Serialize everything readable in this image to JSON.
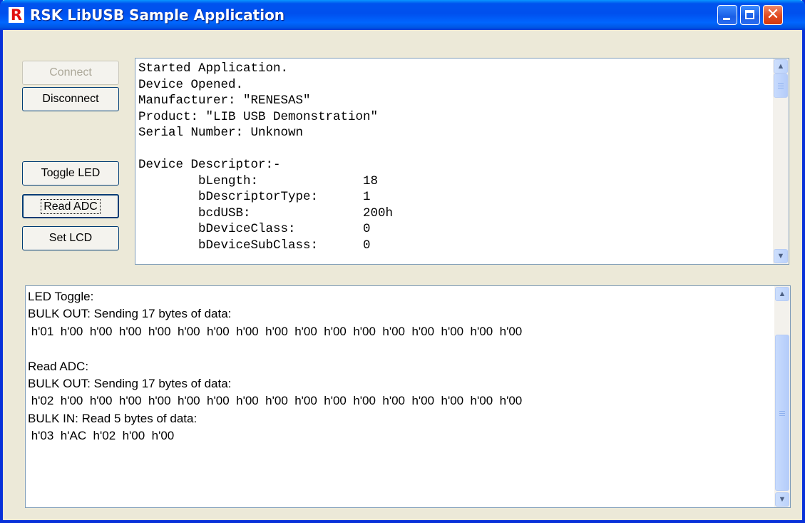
{
  "window": {
    "title": "RSK LibUSB Sample Application",
    "icon": "renesas-r-icon",
    "icon_letter": "R"
  },
  "controls": {
    "minimize": "minimize-icon",
    "maximize": "maximize-icon",
    "close": "close-icon",
    "close_glyph": "✕"
  },
  "buttons": {
    "connect": {
      "label": "Connect",
      "enabled": false
    },
    "disconnect": {
      "label": "Disconnect",
      "enabled": true
    },
    "toggle_led": {
      "label": "Toggle LED",
      "enabled": true
    },
    "read_adc": {
      "label": "Read ADC",
      "enabled": true,
      "focused": true
    },
    "set_lcd": {
      "label": "Set LCD",
      "enabled": true
    }
  },
  "device_log": {
    "lines": [
      "Started Application.",
      "Device Opened.",
      "Manufacturer: \"RENESAS\"",
      "Product: \"LIB USB Demonstration\"",
      "Serial Number: Unknown",
      "",
      "Device Descriptor:-",
      "        bLength:              18",
      "        bDescriptorType:      1",
      "        bcdUSB:               200h",
      "        bDeviceClass:         0",
      "        bDeviceSubClass:      0"
    ]
  },
  "transfer_log": {
    "lines": [
      "LED Toggle:",
      "BULK OUT: Sending 17 bytes of data:",
      " h'01  h'00  h'00  h'00  h'00  h'00  h'00  h'00  h'00  h'00  h'00  h'00  h'00  h'00  h'00  h'00  h'00",
      "",
      "Read ADC:",
      "BULK OUT: Sending 17 bytes of data:",
      " h'02  h'00  h'00  h'00  h'00  h'00  h'00  h'00  h'00  h'00  h'00  h'00  h'00  h'00  h'00  h'00  h'00",
      "BULK IN: Read 5 bytes of data:",
      " h'03  h'AC  h'02  h'00  h'00"
    ]
  },
  "scroll": {
    "up_glyph": "▲",
    "down_glyph": "▼"
  }
}
